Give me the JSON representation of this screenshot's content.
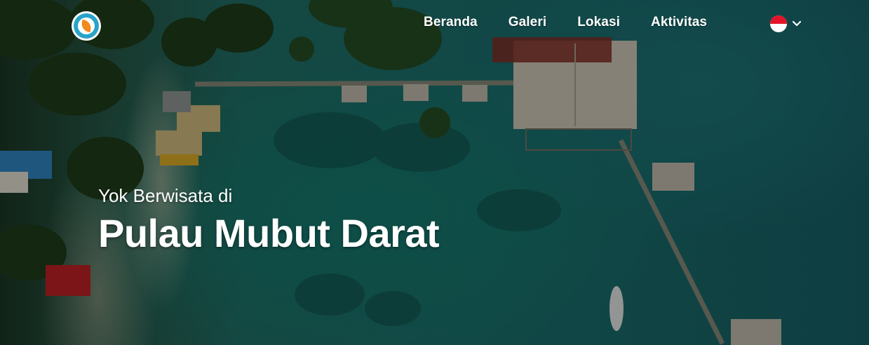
{
  "header": {
    "logo_icon": "leaf-logo-icon",
    "nav": [
      {
        "label": "Beranda"
      },
      {
        "label": "Galeri"
      },
      {
        "label": "Lokasi"
      },
      {
        "label": "Aktivitas"
      }
    ],
    "language": {
      "flag": "indonesia-flag-icon",
      "dropdown_icon": "chevron-down-icon"
    }
  },
  "hero": {
    "subtitle": "Yok Berwisata di",
    "title": "Pulau Mubut Darat"
  },
  "colors": {
    "logo_ring": "#29a3c7",
    "logo_leaf": "#f28a1f",
    "flag_red": "#e3132a",
    "text": "#ffffff"
  }
}
